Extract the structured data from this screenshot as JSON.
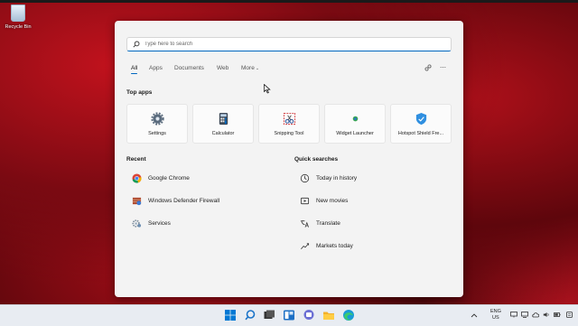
{
  "desktop": {
    "recycle_bin_label": "Recycle Bin"
  },
  "search": {
    "placeholder": "Type here to search",
    "value": ""
  },
  "tabs": [
    "All",
    "Apps",
    "Documents",
    "Web",
    "More"
  ],
  "tools": {
    "share_icon": "share-icon",
    "more_icon": "ellipsis-icon"
  },
  "top_apps": {
    "heading": "Top apps",
    "items": [
      {
        "label": "Settings",
        "icon": "gear-icon"
      },
      {
        "label": "Calculator",
        "icon": "calculator-icon"
      },
      {
        "label": "Snipping Tool",
        "icon": "scissors-icon"
      },
      {
        "label": "Widget Launcher",
        "icon": "widget-icon"
      },
      {
        "label": "Hotspot Shield Fre...",
        "icon": "shield-icon"
      }
    ]
  },
  "recent": {
    "heading": "Recent",
    "items": [
      {
        "label": "Google Chrome",
        "icon": "chrome-icon"
      },
      {
        "label": "Windows Defender Firewall",
        "icon": "firewall-icon"
      },
      {
        "label": "Services",
        "icon": "services-gear-icon"
      }
    ]
  },
  "quick_searches": {
    "heading": "Quick searches",
    "items": [
      {
        "label": "Today in history",
        "icon": "clock-icon"
      },
      {
        "label": "New movies",
        "icon": "film-icon"
      },
      {
        "label": "Translate",
        "icon": "translate-icon"
      },
      {
        "label": "Markets today",
        "icon": "chart-icon"
      }
    ]
  },
  "taskbar": {
    "icons": [
      "windows-start-icon",
      "search-icon",
      "task-view-icon",
      "widgets-icon",
      "teams-chat-icon",
      "file-explorer-icon",
      "edge-icon"
    ],
    "language": "ENG",
    "region": "US"
  },
  "colors": {
    "accent": "#0067c0",
    "menu_bg": "#f3f3f3",
    "desktop": "#8e0b14"
  }
}
